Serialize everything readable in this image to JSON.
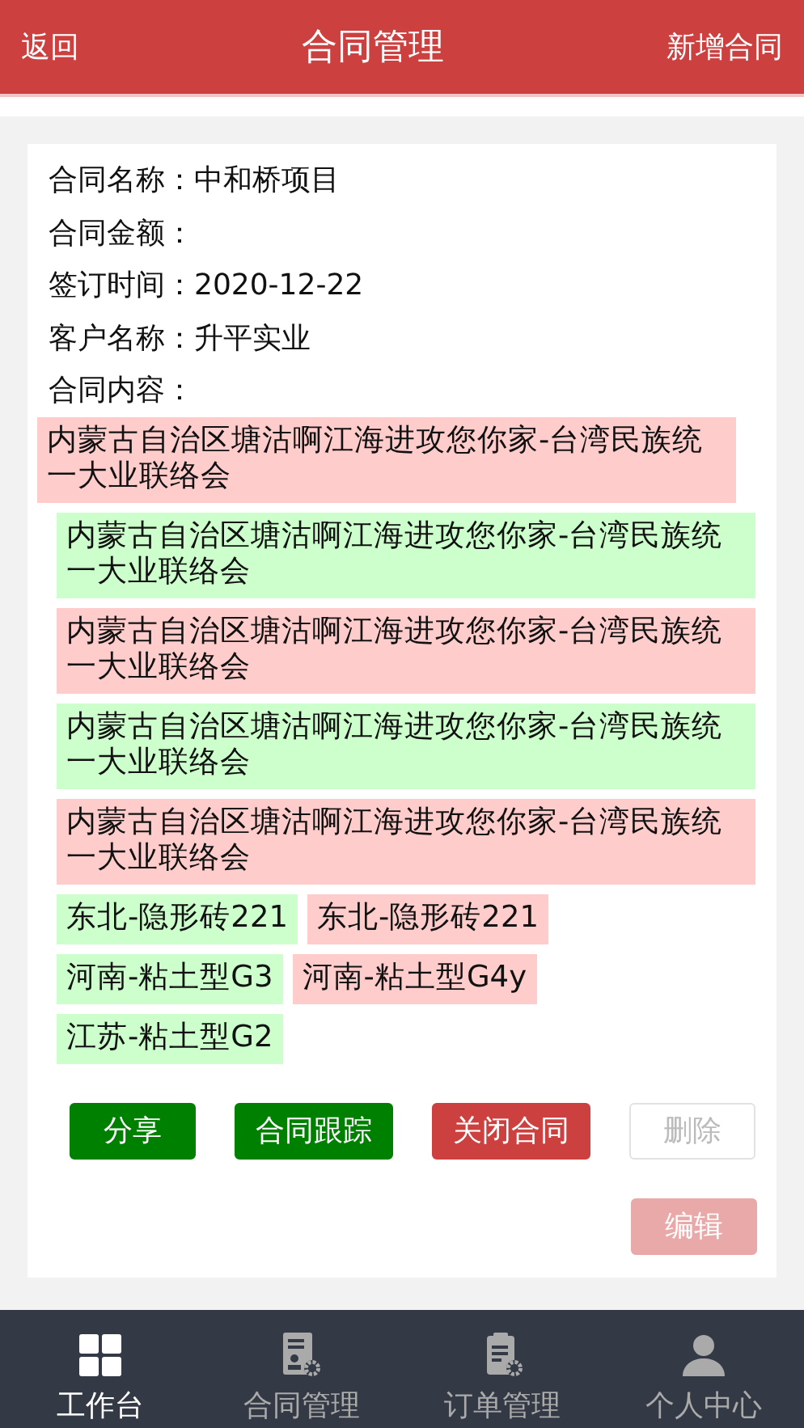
{
  "header": {
    "back": "返回",
    "title": "合同管理",
    "action": "新增合同"
  },
  "fields": [
    {
      "label": "合同名称：",
      "value": "中和桥项目"
    },
    {
      "label": "合同金额："
    },
    {
      "label": "签订时间：",
      "value": "2020-12-22"
    },
    {
      "label": "客户名称：",
      "value": "升平实业"
    },
    {
      "label": "合同内容："
    }
  ],
  "content": {
    "text": "内蒙古自治区塘沽啊江海进攻您你家-台湾民族统一大业联络会",
    "color": "#ffcccc",
    "children": [
      {
        "text": "内蒙古自治区塘沽啊江海进攻您你家-台湾民族统一大业联络会",
        "color": "#ccffcc",
        "kind": "wide"
      },
      {
        "text": "内蒙古自治区塘沽啊江海进攻您你家-台湾民族统一大业联络会",
        "color": "#ffcccc",
        "kind": "wide"
      },
      {
        "text": "内蒙古自治区塘沽啊江海进攻您你家-台湾民族统一大业联络会",
        "color": "#ccffcc",
        "kind": "wide"
      },
      {
        "text": "内蒙古自治区塘沽啊江海进攻您你家-台湾民族统一大业联络会",
        "color": "#ffcccc",
        "kind": "wide"
      },
      {
        "text": "东北-隐形砖221",
        "color": "#ccffcc",
        "kind": "tag"
      },
      {
        "text": "东北-隐形砖221",
        "color": "#ffcccc",
        "kind": "tag"
      },
      {
        "text": "河南-粘土型G3",
        "color": "#ccffcc",
        "kind": "tag"
      },
      {
        "text": "河南-粘土型G4y",
        "color": "#ffcccc",
        "kind": "tag"
      },
      {
        "text": "江苏-粘土型G2",
        "color": "#ccffcc",
        "kind": "tag"
      }
    ]
  },
  "actions": [
    {
      "label": "分享",
      "kind": "green",
      "disabled": false
    },
    {
      "label": "合同跟踪",
      "kind": "green",
      "disabled": false
    },
    {
      "label": "关闭合同",
      "kind": "red",
      "disabled": false
    },
    {
      "label": "删除",
      "kind": "outline",
      "disabled": true
    }
  ],
  "edit": {
    "label": "编辑",
    "kind": "red",
    "disabled": true
  },
  "tabs": [
    {
      "label": "工作台",
      "kind": "grid",
      "selected": true
    },
    {
      "label": "合同管理",
      "kind": "contract",
      "selected": false
    },
    {
      "label": "订单管理",
      "kind": "clipboard",
      "selected": false
    },
    {
      "label": "个人中心",
      "kind": "person",
      "selected": false
    }
  ]
}
